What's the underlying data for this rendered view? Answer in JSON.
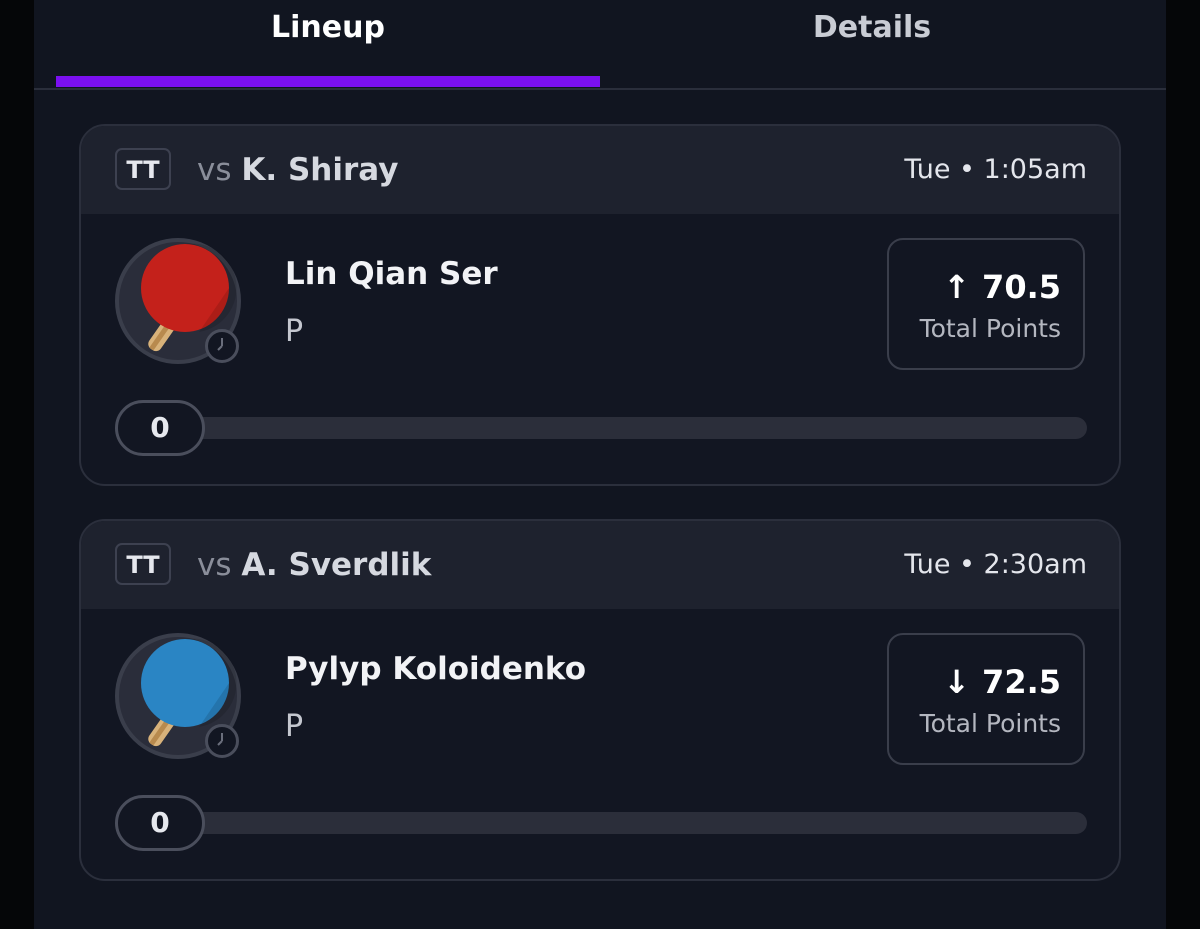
{
  "tabs": [
    {
      "label": "Lineup",
      "active": true
    },
    {
      "label": "Details",
      "active": false
    }
  ],
  "accent_color": "#7b10f0",
  "cards": [
    {
      "sport_badge": "TT",
      "vs_label": "vs",
      "opponent": "K. Shiray",
      "time": "Tue • 1:05am",
      "player_name": "Lin Qian Ser",
      "position": "P",
      "paddle_color": "#c4211b",
      "direction_icon": "arrow-up-icon",
      "arrow_glyph": "↑",
      "points": "70.5",
      "points_label": "Total Points",
      "progress_value": "0"
    },
    {
      "sport_badge": "TT",
      "vs_label": "vs",
      "opponent": "A. Sverdlik",
      "time": "Tue • 2:30am",
      "player_name": "Pylyp Koloidenko",
      "position": "P",
      "paddle_color": "#2a85c4",
      "direction_icon": "arrow-down-icon",
      "arrow_glyph": "↓",
      "points": "72.5",
      "points_label": "Total Points",
      "progress_value": "0"
    }
  ]
}
